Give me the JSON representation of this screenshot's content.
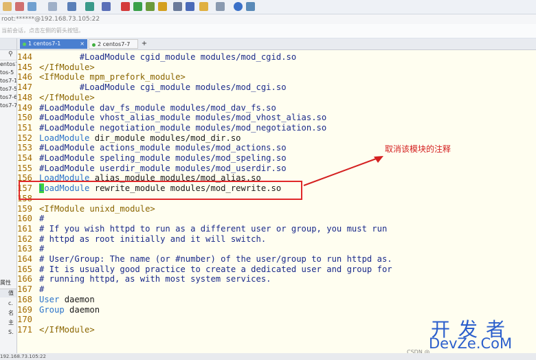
{
  "connection": {
    "title": "root:******@192.168.73.105:22"
  },
  "hint": {
    "text": "当前会话，点击左侧的箭头按钮。"
  },
  "sidebar": {
    "sessions": [
      "entos7 -",
      "tos-5",
      "tos7-1",
      "tos7-5",
      "tos7-6",
      "tos7-7"
    ],
    "properties_label": "属性",
    "prop_header": "值",
    "prop_rows": [
      "c.",
      "名",
      "主",
      "S."
    ]
  },
  "tabs": [
    {
      "label": "1 centos7-1",
      "close": "×",
      "dot_color": "#5bd05b"
    },
    {
      "label": "2 centos7-7",
      "close": "",
      "dot_color": "#3fae3f"
    }
  ],
  "add_tab": "+",
  "code_lines": [
    {
      "num": "144",
      "segments": [
        {
          "cls": "c-comment",
          "text": "        #LoadModule cgid_module modules/mod_cgid.so"
        }
      ]
    },
    {
      "num": "145",
      "segments": [
        {
          "cls": "c-tag",
          "text": "</IfModule>"
        }
      ]
    },
    {
      "num": "146",
      "segments": [
        {
          "cls": "c-tag",
          "text": "<IfModule mpm_prefork_module>"
        }
      ]
    },
    {
      "num": "147",
      "segments": [
        {
          "cls": "c-comment",
          "text": "        #LoadModule cgi_module modules/mod_cgi.so"
        }
      ]
    },
    {
      "num": "148",
      "segments": [
        {
          "cls": "c-tag",
          "text": "</IfModule>"
        }
      ]
    },
    {
      "num": "149",
      "segments": [
        {
          "cls": "c-comment",
          "text": "#LoadModule dav_fs_module modules/mod_dav_fs.so"
        }
      ]
    },
    {
      "num": "150",
      "segments": [
        {
          "cls": "c-comment",
          "text": "#LoadModule vhost_alias_module modules/mod_vhost_alias.so"
        }
      ]
    },
    {
      "num": "151",
      "segments": [
        {
          "cls": "c-comment",
          "text": "#LoadModule negotiation_module modules/mod_negotiation.so"
        }
      ]
    },
    {
      "num": "152",
      "segments": [
        {
          "cls": "c-kw",
          "text": "LoadModule"
        },
        {
          "cls": "c-plain",
          "text": " dir_module modules/mod_dir.so"
        }
      ]
    },
    {
      "num": "153",
      "segments": [
        {
          "cls": "c-comment",
          "text": "#LoadModule actions_module modules/mod_actions.so"
        }
      ]
    },
    {
      "num": "154",
      "segments": [
        {
          "cls": "c-comment",
          "text": "#LoadModule speling_module modules/mod_speling.so"
        }
      ]
    },
    {
      "num": "155",
      "segments": [
        {
          "cls": "c-comment",
          "text": "#LoadModule userdir_module modules/mod_userdir.so"
        }
      ]
    },
    {
      "num": "156",
      "segments": [
        {
          "cls": "c-kw",
          "text": "LoadModule"
        },
        {
          "cls": "c-plain",
          "text": " alias_module modules/mod_alias.so"
        }
      ]
    },
    {
      "num": "157",
      "segments": [
        {
          "cls": "cursor",
          "text": "L"
        },
        {
          "cls": "c-kw",
          "text": "oadModule"
        },
        {
          "cls": "c-plain",
          "text": " rewrite_module modules/mod_rewrite.so"
        }
      ]
    },
    {
      "num": "158",
      "segments": [
        {
          "cls": "c-plain",
          "text": ""
        }
      ]
    },
    {
      "num": "159",
      "segments": [
        {
          "cls": "c-tag",
          "text": "<IfModule unixd_module>"
        }
      ]
    },
    {
      "num": "160",
      "segments": [
        {
          "cls": "c-comment",
          "text": "#"
        }
      ]
    },
    {
      "num": "161",
      "segments": [
        {
          "cls": "c-comment",
          "text": "# If you wish httpd to run as a different user or group, you must run"
        }
      ]
    },
    {
      "num": "162",
      "segments": [
        {
          "cls": "c-comment",
          "text": "# httpd as root initially and it will switch."
        }
      ]
    },
    {
      "num": "163",
      "segments": [
        {
          "cls": "c-comment",
          "text": "#"
        }
      ]
    },
    {
      "num": "164",
      "segments": [
        {
          "cls": "c-comment",
          "text": "# User/Group: The name (or #number) of the user/group to run httpd as."
        }
      ]
    },
    {
      "num": "165",
      "segments": [
        {
          "cls": "c-comment",
          "text": "# It is usually good practice to create a dedicated user and group for"
        }
      ]
    },
    {
      "num": "166",
      "segments": [
        {
          "cls": "c-comment",
          "text": "# running httpd, as with most system services."
        }
      ]
    },
    {
      "num": "167",
      "segments": [
        {
          "cls": "c-comment",
          "text": "#"
        }
      ]
    },
    {
      "num": "168",
      "segments": [
        {
          "cls": "c-kw",
          "text": "User"
        },
        {
          "cls": "c-plain",
          "text": " daemon"
        }
      ]
    },
    {
      "num": "169",
      "segments": [
        {
          "cls": "c-kw",
          "text": "Group"
        },
        {
          "cls": "c-plain",
          "text": " daemon"
        }
      ]
    },
    {
      "num": "170",
      "segments": [
        {
          "cls": "c-plain",
          "text": ""
        }
      ]
    },
    {
      "num": "171",
      "segments": [
        {
          "cls": "c-tag",
          "text": "</IfModule>"
        }
      ]
    }
  ],
  "annotation": {
    "text": "取消该模块的注释",
    "color": "#d42020"
  },
  "watermark": {
    "cn": "开发者",
    "en": "DevZe.CoM"
  },
  "csdn": "CSDN @...",
  "status": {
    "text": "192.168.73.105:22"
  },
  "colors": {
    "accent_tab": "#4a7fd0",
    "editor_bg": "#fffef0",
    "highlight": "#e0282a"
  }
}
